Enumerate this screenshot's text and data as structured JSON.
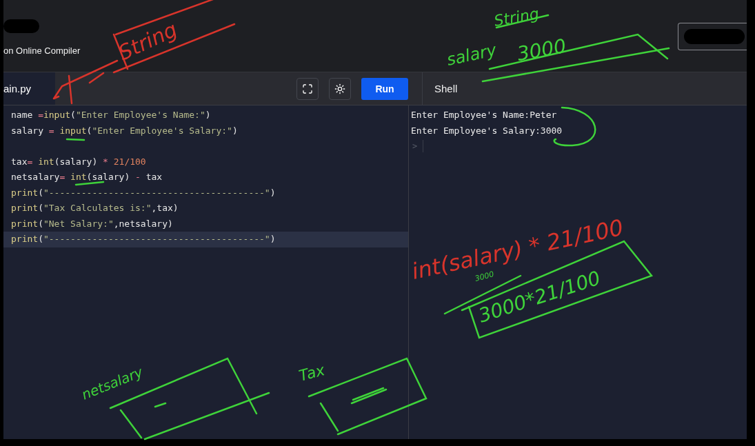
{
  "header": {
    "brand": "on Online Compiler",
    "redacted": true
  },
  "editor": {
    "tabs": [
      {
        "label": "ain.py",
        "selected": true
      }
    ],
    "run_button": "Run",
    "lines": [
      {
        "tokens": [
          {
            "kind": "name",
            "text": "name "
          },
          {
            "kind": "op",
            "text": "="
          },
          {
            "kind": "func",
            "text": "input"
          },
          {
            "kind": "punct",
            "text": "("
          },
          {
            "kind": "string",
            "text": "\"Enter Employee's Name:\""
          },
          {
            "kind": "punct",
            "text": ")"
          }
        ],
        "current": false
      },
      {
        "tokens": [
          {
            "kind": "name",
            "text": "salary "
          },
          {
            "kind": "op",
            "text": "= "
          },
          {
            "kind": "func",
            "text": "input"
          },
          {
            "kind": "punct",
            "text": "("
          },
          {
            "kind": "string",
            "text": "\"Enter Employee's Salary:\""
          },
          {
            "kind": "punct",
            "text": ")"
          }
        ],
        "current": false
      },
      {
        "current": false
      },
      {
        "tokens": [
          {
            "kind": "name",
            "text": "tax"
          },
          {
            "kind": "op",
            "text": "= "
          },
          {
            "kind": "func",
            "text": "int"
          },
          {
            "kind": "punct",
            "text": "(salary) "
          },
          {
            "kind": "op",
            "text": "* "
          },
          {
            "kind": "number",
            "text": "21/100"
          }
        ],
        "current": false
      },
      {
        "tokens": [
          {
            "kind": "name",
            "text": "netsalary"
          },
          {
            "kind": "op",
            "text": "= "
          },
          {
            "kind": "func",
            "text": "int"
          },
          {
            "kind": "punct",
            "text": "(salary) "
          },
          {
            "kind": "op",
            "text": "- "
          },
          {
            "kind": "name",
            "text": "tax"
          }
        ],
        "current": false
      },
      {
        "tokens": [
          {
            "kind": "func",
            "text": "print"
          },
          {
            "kind": "punct",
            "text": "("
          },
          {
            "kind": "string",
            "text": "\"----------------------------------------\""
          },
          {
            "kind": "punct",
            "text": ")"
          }
        ],
        "current": false
      },
      {
        "tokens": [
          {
            "kind": "func",
            "text": "print"
          },
          {
            "kind": "punct",
            "text": "("
          },
          {
            "kind": "string",
            "text": "\"Tax Calculates is:\""
          },
          {
            "kind": "punct",
            "text": ",tax)"
          }
        ],
        "current": false
      },
      {
        "tokens": [
          {
            "kind": "func",
            "text": "print"
          },
          {
            "kind": "punct",
            "text": "("
          },
          {
            "kind": "string",
            "text": "\"Net Salary:\""
          },
          {
            "kind": "punct",
            "text": ",netsalary)"
          }
        ],
        "current": false
      },
      {
        "tokens": [
          {
            "kind": "func",
            "text": "print"
          },
          {
            "kind": "punct",
            "text": "("
          },
          {
            "kind": "string",
            "text": "\"----------------------------------------\""
          },
          {
            "kind": "punct",
            "text": ")"
          }
        ],
        "current": true
      }
    ]
  },
  "shell": {
    "title": "Shell",
    "lines": [
      "Enter Employee's Name:Peter",
      "Enter Employee's Salary:3000"
    ],
    "prompt": ">"
  },
  "annotations": [
    {
      "text": "String",
      "color": "#d8342b"
    },
    {
      "text": "String",
      "color": "#3fd33a"
    },
    {
      "text": "salary",
      "color": "#3fd33a"
    },
    {
      "text": "3000",
      "color": "#3fd33a"
    },
    {
      "text": "int(salary) * 21/100",
      "color": "#d8342b"
    },
    {
      "text": "3000",
      "color": "#3fd33a"
    },
    {
      "text": "3000*21/100",
      "color": "#3fd33a"
    },
    {
      "text": "netsalary",
      "color": "#3fd33a"
    },
    {
      "text": "Tax",
      "color": "#3fd33a"
    }
  ]
}
